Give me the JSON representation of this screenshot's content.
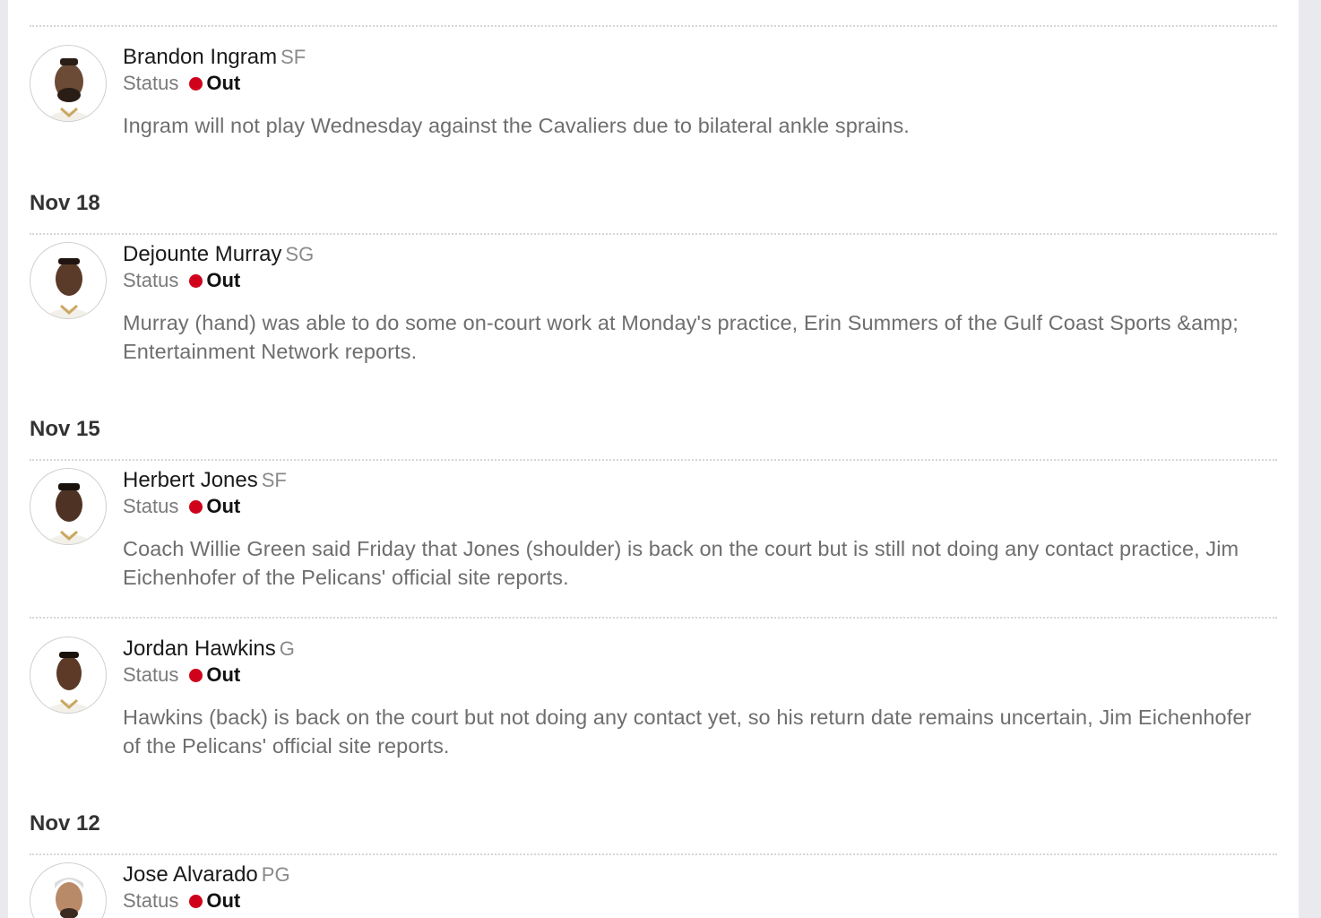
{
  "status_label": "Status",
  "accent_colors": {
    "out_dot": "#d0021b"
  },
  "sections": [
    {
      "date": "",
      "entries": [
        {
          "name": "Brandon Ingram",
          "position": "SF",
          "status": "Out",
          "avatar_icon": "player-headshot-icon",
          "note": "Ingram will not play Wednesday against the Cavaliers due to bilateral ankle sprains."
        }
      ]
    },
    {
      "date": "Nov 18",
      "entries": [
        {
          "name": "Dejounte Murray",
          "position": "SG",
          "status": "Out",
          "avatar_icon": "player-headshot-icon",
          "note": "Murray (hand) was able to do some on-court work at Monday's practice, Erin Summers of the Gulf Coast Sports &amp; Entertainment Network reports."
        }
      ]
    },
    {
      "date": "Nov 15",
      "entries": [
        {
          "name": "Herbert Jones",
          "position": "SF",
          "status": "Out",
          "avatar_icon": "player-headshot-icon",
          "note": "Coach Willie Green said Friday that Jones (shoulder) is back on the court but is still not doing any contact practice, Jim Eichenhofer of the Pelicans' official site reports."
        },
        {
          "name": "Jordan Hawkins",
          "position": "G",
          "status": "Out",
          "avatar_icon": "player-headshot-icon",
          "note": "Hawkins (back) is back on the court but not doing any contact yet, so his return date remains uncertain, Jim Eichenhofer of the Pelicans' official site reports."
        }
      ]
    },
    {
      "date": "Nov 12",
      "entries": [
        {
          "name": "Jose Alvarado",
          "position": "PG",
          "status": "Out",
          "avatar_icon": "player-headshot-icon",
          "note": ""
        }
      ]
    }
  ]
}
